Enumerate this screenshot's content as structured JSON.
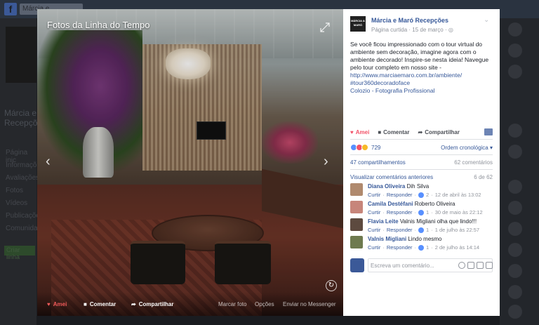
{
  "background": {
    "search_text": "Márcia e",
    "page_name_partial": "Márcia e Recepçõe",
    "nav_items": [
      "Página inic",
      "Informações",
      "Avaliações",
      "Fotos",
      "Vídeos",
      "Publicações",
      "Comunidade"
    ],
    "cta_button": "Criar linha"
  },
  "photo": {
    "album_title": "Fotos da Linha do Tempo",
    "actions": {
      "love": "Amei",
      "comment": "Comentar",
      "share": "Compartilhar",
      "tag": "Marcar foto",
      "options": "Opções",
      "send": "Enviar no Messenger"
    }
  },
  "post": {
    "page_name": "Márcia e Maró Recepções",
    "logo_text": "MÁRCIA & MARÓ",
    "meta": "Página curtida · 15 de março ·",
    "text": "Se você ficou impressionado com o tour virtual do ambiente sem decoração, imagine agora com o ambiente decorado! Inspire-se nesta ideia! Navegue pelo tour completo em nosso site -",
    "link_url": "http://www.marciaemaro.com.br/ambiente/",
    "hashtag": "#tour360decoradoface",
    "credit": "Colozio - Fotografia Profissional",
    "actions": {
      "love": "Amei",
      "comment": "Comentar",
      "share": "Compartilhar"
    },
    "reaction_count": "729",
    "order_label": "Ordem cronológica",
    "shares": "47 compartilhamentos",
    "comments_count": "62 comentários",
    "view_previous": "Visualizar comentários anteriores",
    "comments_position": "6 de 62"
  },
  "comments": [
    {
      "author": "Diana Oliveira",
      "text": "Dih Silva",
      "like": "Curtir",
      "reply": "Responder",
      "reactions": "2",
      "time": "12 de abril às 13:02"
    },
    {
      "author": "Camila Destéfani",
      "text": "Roberto Oliveira",
      "like": "Curtir",
      "reply": "Responder",
      "reactions": "1",
      "time": "30 de maio às 22:12"
    },
    {
      "author": "Flavia Leite",
      "text": "Valnis Migliani olha que lindo!!!",
      "like": "Curtir",
      "reply": "Responder",
      "reactions": "1",
      "time": "1 de julho às 22:57"
    },
    {
      "author": "Valnis Migliani",
      "text": "Lindo mesmo",
      "like": "Curtir",
      "reply": "Responder",
      "reactions": "1",
      "time": "2 de julho às 14:14"
    }
  ],
  "composer": {
    "placeholder": "Escreva um comentário..."
  },
  "colors": {
    "link": "#365899",
    "love": "#f25268",
    "muted": "#90949c"
  }
}
